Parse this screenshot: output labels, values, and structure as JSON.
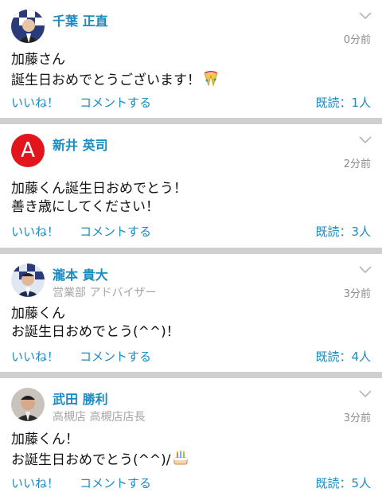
{
  "posts": [
    {
      "author": "千葉 正直",
      "subtitle": "",
      "time": "0分前",
      "lines": "加藤さん\n誕生日おめでとうございます！",
      "emoji": "party-popper",
      "like_label": "いいね！",
      "comment_label": "コメントする",
      "read_label": "既読：1人",
      "avatar_type": "photo"
    },
    {
      "author": "新井 英司",
      "subtitle": "",
      "time": "2分前",
      "lines": "加藤くん誕生日おめでとう！\n善き歳にしてください！",
      "emoji": "",
      "like_label": "いいね！",
      "comment_label": "コメントする",
      "read_label": "既読：3人",
      "avatar_type": "letter",
      "avatar_letter": "A",
      "avatar_color": "#e2141c"
    },
    {
      "author": "瀧本 貴大",
      "subtitle": "営業部 アドバイザー",
      "time": "3分前",
      "lines": "加藤くん\nお誕生日おめでとう(^^)！",
      "emoji": "",
      "like_label": "いいね！",
      "comment_label": "コメントする",
      "read_label": "既読：4人",
      "avatar_type": "photo"
    },
    {
      "author": "武田 勝利",
      "subtitle": "高槻店 高槻店店長",
      "time": "3分前",
      "lines": "加藤くん！\nお誕生日おめでとう(^^)/",
      "emoji": "birthday-cake",
      "like_label": "いいね！",
      "comment_label": "コメントする",
      "read_label": "既読：5人",
      "avatar_type": "photo"
    }
  ],
  "colors": {
    "accent": "#1a8bc1",
    "separator": "#cfcfcf",
    "muted": "#8c8c8c"
  }
}
